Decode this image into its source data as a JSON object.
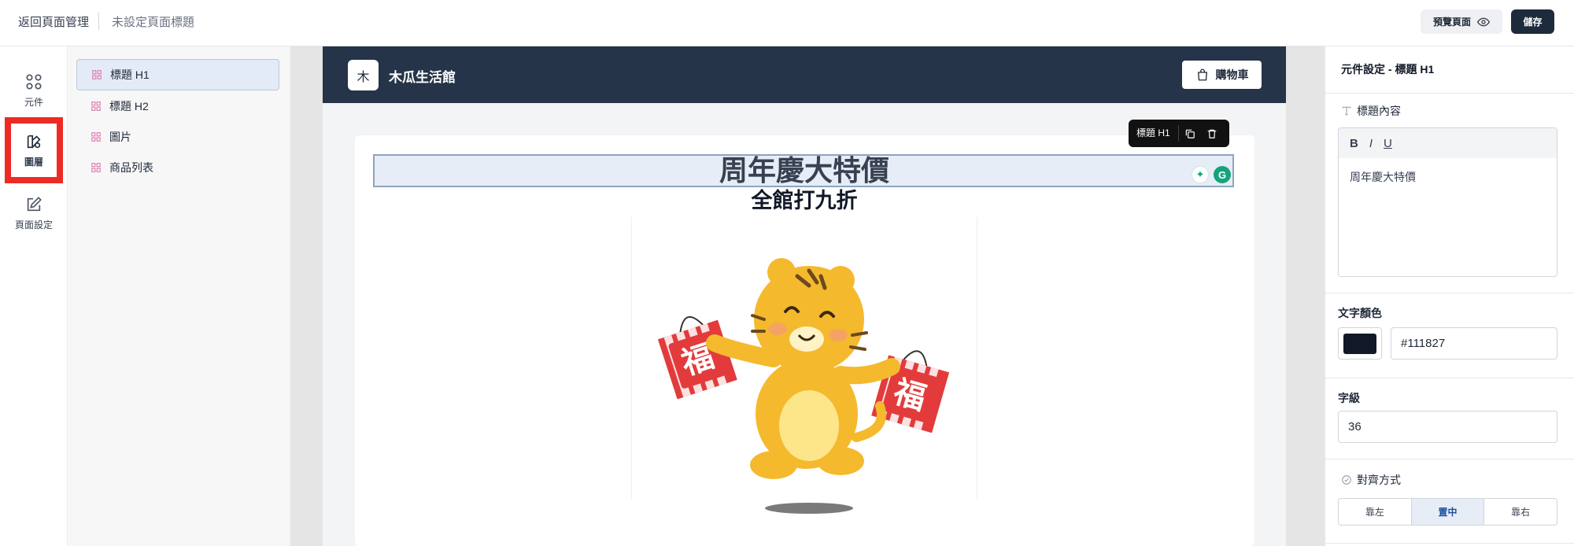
{
  "topbar": {
    "back_label": "返回頁面管理",
    "page_title": "未設定頁面標題",
    "preview_label": "預覽頁面",
    "save_label": "儲存"
  },
  "rail": {
    "items": [
      {
        "label": "元件",
        "icon": "grid-icon"
      },
      {
        "label": "圖層",
        "icon": "layers-icon",
        "active": true
      },
      {
        "label": "頁面設定",
        "icon": "edit-icon"
      }
    ]
  },
  "layers": {
    "items": [
      {
        "label": "標題 H1",
        "selected": true
      },
      {
        "label": "標題 H2"
      },
      {
        "label": "圖片"
      },
      {
        "label": "商品列表"
      }
    ]
  },
  "site": {
    "logo_char": "木",
    "name": "木瓜生活館",
    "cart_label": "購物車",
    "h1": "周年慶大特價",
    "h2": "全館打九折",
    "floating_toolbar_label": "標題 H1"
  },
  "props": {
    "title": "元件設定 - 標題 H1",
    "heading_content_label": "標題內容",
    "editor_text": "周年慶大特價",
    "text_color_label": "文字顏色",
    "text_color_value": "#111827",
    "font_size_label": "字級",
    "font_size_value": "36",
    "align_label": "對齊方式",
    "align_options": [
      "靠左",
      "置中",
      "靠右"
    ],
    "align_selected": "置中"
  },
  "colors": {
    "header_bg": "#253448",
    "save_bg": "#1e2b3c",
    "highlight": "#ee2a24"
  }
}
